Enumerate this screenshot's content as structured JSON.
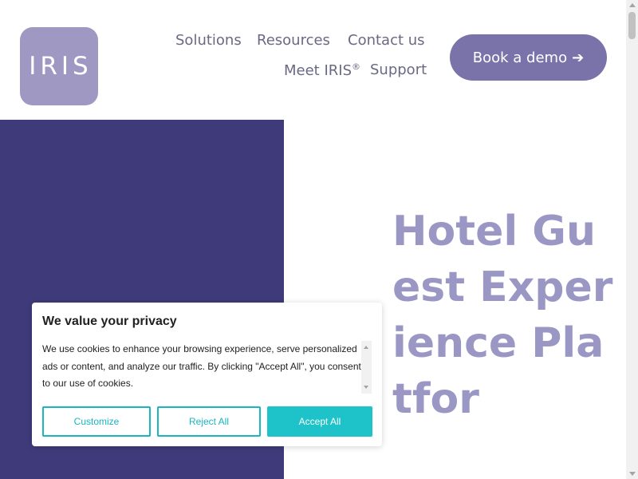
{
  "header": {
    "logo_text": "IRIS",
    "nav": {
      "solutions": "Solutions",
      "resources": "Resources",
      "contact": "Contact us",
      "meet": "Meet IRIS",
      "meet_mark": "®",
      "support": "Support"
    },
    "demo_button": {
      "label": "Book a demo",
      "arrow": "➔"
    }
  },
  "hero": {
    "title": "Hotel Guest Experience Platfor"
  },
  "cookie_banner": {
    "title": "We value your privacy",
    "body": "We use cookies to enhance your browsing experience, serve personalized ads or content, and analyze our traffic. By clicking \"Accept All\", you consent to our use of cookies.",
    "customize": "Customize",
    "reject": "Reject All",
    "accept": "Accept All"
  },
  "colors": {
    "brand_purple": "#3f3a7a",
    "logo_lavender": "#9e98c3",
    "button_purple": "#7a73aa",
    "hero_text": "#9b97c5",
    "cookie_teal": "#1ec3c9"
  }
}
